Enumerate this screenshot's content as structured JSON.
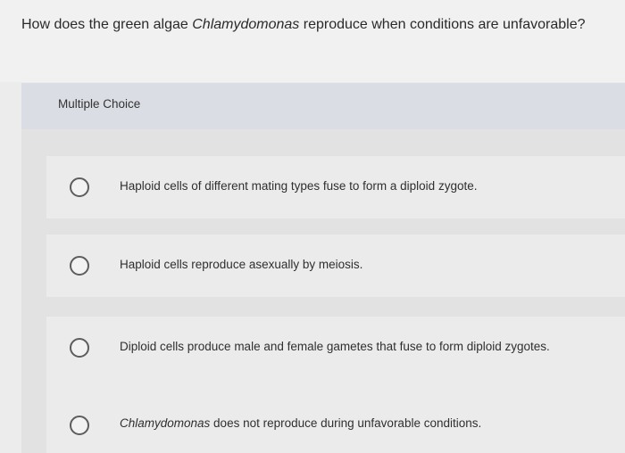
{
  "question": {
    "prefix": "How does the green algae ",
    "emphasis": "Chlamydomonas",
    "suffix": " reproduce when conditions are unfavorable?"
  },
  "header": {
    "label": "Multiple Choice"
  },
  "options": [
    {
      "emphasis": "",
      "text": "Haploid cells of different mating types fuse to form a diploid zygote."
    },
    {
      "emphasis": "",
      "text": "Haploid cells reproduce asexually by meiosis."
    },
    {
      "emphasis": "",
      "text": "Diploid cells produce male and female gametes that fuse to form diploid zygotes."
    },
    {
      "emphasis": "Chlamydomonas",
      "text": " does not reproduce during unfavorable conditions."
    }
  ]
}
